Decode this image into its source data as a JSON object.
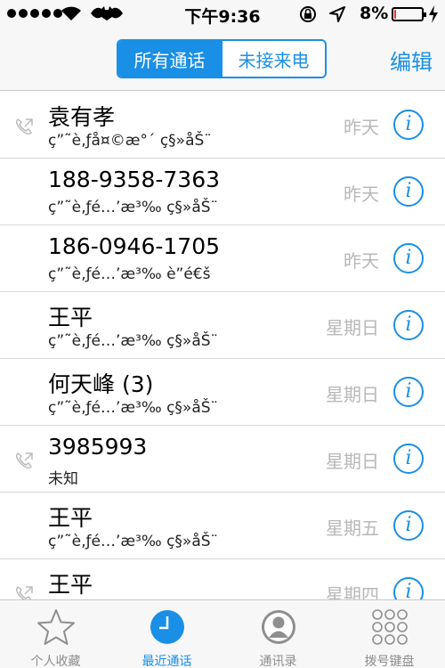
{
  "status": {
    "time": "下午9:36",
    "battery": "8%",
    "battery_level": 0.08
  },
  "segments": [
    {
      "label": "所有通话",
      "active": true
    },
    {
      "label": "未接来电",
      "active": false
    }
  ],
  "edit_label": "编辑",
  "calls": [
    {
      "name": "袁有孝",
      "type": "ç”˜è‚ƒå¤©æ°´ ç§»åŠ¨",
      "date": "昨天",
      "outgoing": true
    },
    {
      "name": "188-9358-7363",
      "type": "ç”˜è‚ƒé…’æ³‰ ç§»åŠ¨",
      "date": "昨天",
      "outgoing": false
    },
    {
      "name": "186-0946-1705",
      "type": "ç”˜è‚ƒé…’æ³‰ è”é€š",
      "date": "昨天",
      "outgoing": false
    },
    {
      "name": "王平",
      "type": "ç”˜è‚ƒé…’æ³‰ ç§»åŠ¨",
      "date": "星期日",
      "outgoing": false
    },
    {
      "name": "何天峰 (3)",
      "type": "ç”˜è‚ƒé…’æ³‰ ç§»åŠ¨",
      "date": "星期日",
      "outgoing": false
    },
    {
      "name": "3985993",
      "type": "未知",
      "date": "星期日",
      "outgoing": true
    },
    {
      "name": "王平",
      "type": "ç”˜è‚ƒé…’æ³‰ ç§»åŠ¨",
      "date": "星期五",
      "outgoing": false
    },
    {
      "name": "王平",
      "type": "",
      "date": "星期四",
      "outgoing": true
    }
  ],
  "tabs": [
    {
      "label": "个人收藏",
      "icon": "star-icon",
      "active": false
    },
    {
      "label": "最近通话",
      "icon": "clock-icon",
      "active": true
    },
    {
      "label": "通讯录",
      "icon": "contacts-icon",
      "active": false
    },
    {
      "label": "拨号键盘",
      "icon": "keypad-icon",
      "active": false
    }
  ]
}
